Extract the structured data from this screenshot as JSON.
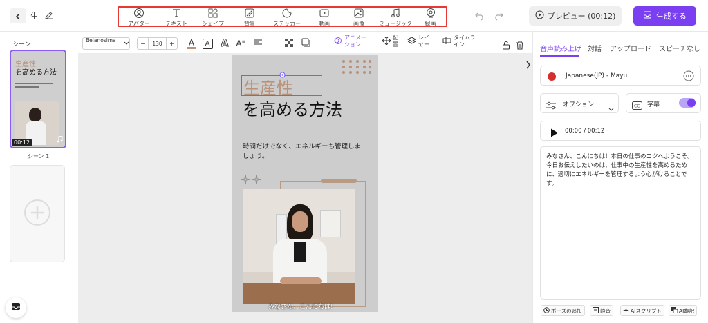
{
  "app": {
    "project_title": "生",
    "preview_label": "プレビュー (00:12)",
    "generate_label": "生成する"
  },
  "toolbar": {
    "tools": [
      {
        "label": "アバター",
        "icon": "avatar-icon"
      },
      {
        "label": "テキスト",
        "icon": "text-icon"
      },
      {
        "label": "シェイプ",
        "icon": "shape-icon"
      },
      {
        "label": "背景",
        "icon": "background-icon"
      },
      {
        "label": "ステッカー",
        "icon": "sticker-icon"
      },
      {
        "label": "動画",
        "icon": "video-icon"
      },
      {
        "label": "画像",
        "icon": "image-icon"
      },
      {
        "label": "ミュージック",
        "icon": "music-icon"
      },
      {
        "label": "録画",
        "icon": "record-icon"
      }
    ]
  },
  "scenes": {
    "label": "シーン",
    "items": [
      {
        "name": "シーン 1",
        "duration": "00:12",
        "thumb_line1": "生産性",
        "thumb_line2": "を高める方法"
      }
    ]
  },
  "format_bar": {
    "font": "Belanosima ...",
    "size": "130",
    "animation_label": "アニメーション",
    "arrange_label": "配置",
    "layer_label": "レイヤー",
    "timeline_label": "タイムライン"
  },
  "canvas": {
    "headline_1": "生産性",
    "headline_2": "を高める方法",
    "body": "時間だけでなく、エネルギーも管理しましょう。",
    "subtitle": "みなさん、こんにちは!"
  },
  "right_panel": {
    "tabs": [
      "音声読み上げ",
      "対話",
      "アップロード",
      "スピーチなし"
    ],
    "active_tab": 0,
    "voice": "Japanese(JP) - Mayu",
    "options_label": "オプション",
    "subtitle_label": "字幕",
    "subtitle_on": true,
    "time": "00:00 / 00:12",
    "script": "みなさん、こんにちは！本日の仕事のコツへようこそ。\n今日お伝えしたいのは、仕事中の生産性を高めるために、適切にエネルギーを管理するよう心がけることです。",
    "bottom_buttons": [
      "ポーズの追加",
      "静音",
      "AIスクリプト",
      "AI翻訳"
    ]
  },
  "colors": {
    "accent": "#7b3ff2",
    "highlight_border": "#e53935",
    "headline_tan": "#b8927a"
  }
}
